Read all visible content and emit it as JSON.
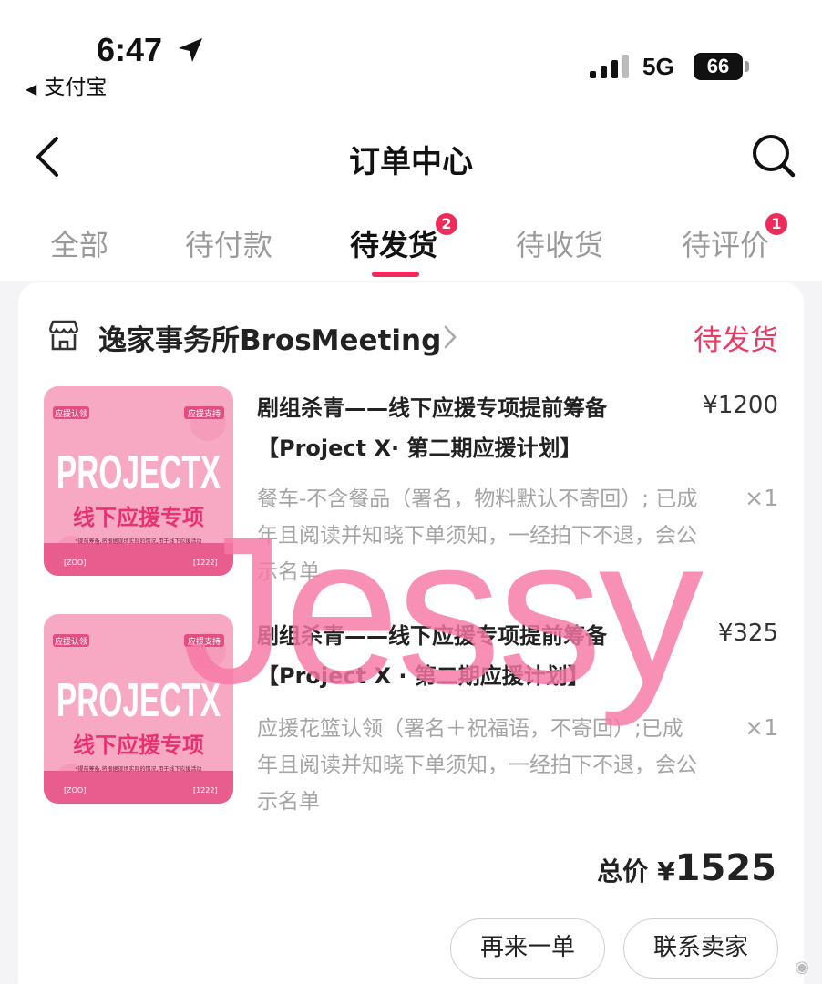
{
  "status_bar": {
    "time": "6:47",
    "back_app": "支付宝",
    "network": "5G",
    "battery": "66"
  },
  "nav": {
    "title": "订单中心"
  },
  "tabs": [
    {
      "label": "全部",
      "active": false
    },
    {
      "label": "待付款",
      "active": false
    },
    {
      "label": "待发货",
      "active": true,
      "badge": "2"
    },
    {
      "label": "待收货",
      "active": false
    },
    {
      "label": "待评价",
      "active": false,
      "badge": "1"
    }
  ],
  "order": {
    "shop_name": "逸家事务所BrosMeeting",
    "status": "待发货",
    "items": [
      {
        "title": "剧组杀青——线下应援专项提前筹备【Project X· 第二期应援计划】",
        "price": "¥1200",
        "spec": "餐车-不含餐品（署名，物料默认不寄回）; 已成年且阅读并知晓下单须知，一经拍下不退，会公示名单",
        "qty": "×1"
      },
      {
        "title": "剧组杀青——线下应援专项提前筹备【Project X · 第二期应援计划】",
        "price": "¥325",
        "spec": "应援花篮认领（署名＋祝福语，不寄回）;已成年且阅读并知晓下单须知，一经拍下不退，会公示名单",
        "qty": "×1"
      }
    ],
    "total_label": "总价",
    "total_currency": "¥",
    "total_amount": "1525",
    "buttons": {
      "reorder": "再来一单",
      "contact": "联系卖家"
    }
  },
  "thumbnail": {
    "tag_left": "应援认领",
    "tag_right": "应援支持",
    "headline": "PROJECTX",
    "subtitle": "线下应援专项",
    "fine_print": "*提前筹备,将根据现场实际的情况,用于线下应援活动",
    "footer_left": "[ZOO]",
    "footer_right": "[1222]"
  },
  "overlays": {
    "watermark": "Jessy"
  },
  "colors": {
    "accent": "#ee2b5b",
    "status_text": "#e83a63",
    "watermark": "#f778a5",
    "thumb_bg": "#f7a9c4"
  }
}
